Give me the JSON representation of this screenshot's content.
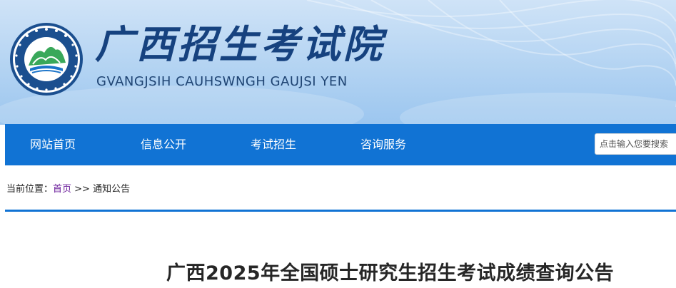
{
  "header": {
    "site_title": "广西招生考试院",
    "site_subtitle": "GVANGJSIH CAUHSWNGH GAUJSI YEN",
    "emblem_ring_text": "广西招生考试院 · GVANGJSIH CAUHSWNGH GAUJSI YEN"
  },
  "nav": {
    "items": [
      {
        "label": "网站首页"
      },
      {
        "label": "信息公开"
      },
      {
        "label": "考试招生"
      },
      {
        "label": "咨询服务"
      }
    ],
    "search": {
      "placeholder": "点击输入您要搜索"
    }
  },
  "breadcrumb": {
    "prefix": "当前位置：",
    "home": "首页",
    "separator": " >> ",
    "current": "通知公告"
  },
  "article": {
    "title": "广西2025年全国硕士研究生招生考试成绩查询公告"
  },
  "colors": {
    "nav_bg": "#1173d4",
    "title_blue": "#16427f",
    "header_light": "#cfe3f7",
    "header_dark": "#9cc6ef"
  }
}
